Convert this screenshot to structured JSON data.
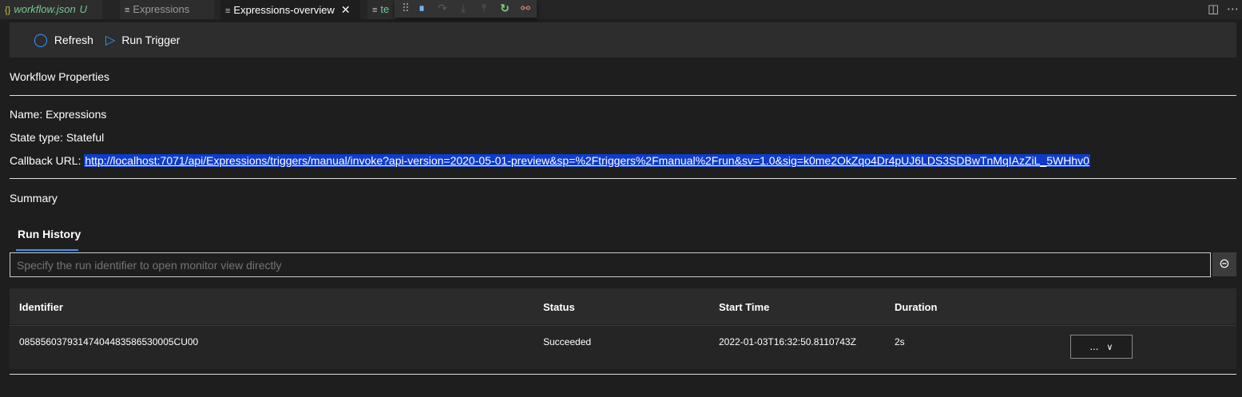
{
  "tabs": [
    {
      "icon": "{}",
      "label": "workflow.json",
      "badge": "U"
    },
    {
      "icon": "≡",
      "label": "Expressions"
    },
    {
      "icon": "≡",
      "label": "Expressions-overview",
      "close": "✕"
    },
    {
      "icon": "≡",
      "label": "te"
    }
  ],
  "toolbar": {
    "refresh_label": "Refresh",
    "run_trigger_label": "Run Trigger"
  },
  "properties": {
    "heading": "Workflow Properties",
    "name": "Name: Expressions",
    "state_type": "State type: Stateful",
    "callback_label": "Callback URL: ",
    "callback_url": "http://localhost:7071/api/Expressions/triggers/manual/invoke?api-version=2020-05-01-preview&sp=%2Ftriggers%2Fmanual%2Frun&sv=1.0&sig=k0me2OkZqo4Dr4pUJ6LDS3SDBwTnMqIAzZiL_5WHhv0"
  },
  "summary": {
    "heading": "Summary"
  },
  "run_history": {
    "tab_label": "Run History",
    "input_placeholder": "Specify the run identifier to open monitor view directly",
    "columns": [
      "Identifier",
      "Status",
      "Start Time",
      "Duration"
    ],
    "rows": [
      {
        "identifier": "08585603793147404483586530005CU00",
        "status": "Succeeded",
        "start_time": "2022-01-03T16:32:50.8110743Z",
        "duration": "2s",
        "action": "..."
      }
    ]
  },
  "colors": {
    "accent": "#3794ff",
    "selection": "#0e3bcc",
    "modified": "#73c991"
  }
}
